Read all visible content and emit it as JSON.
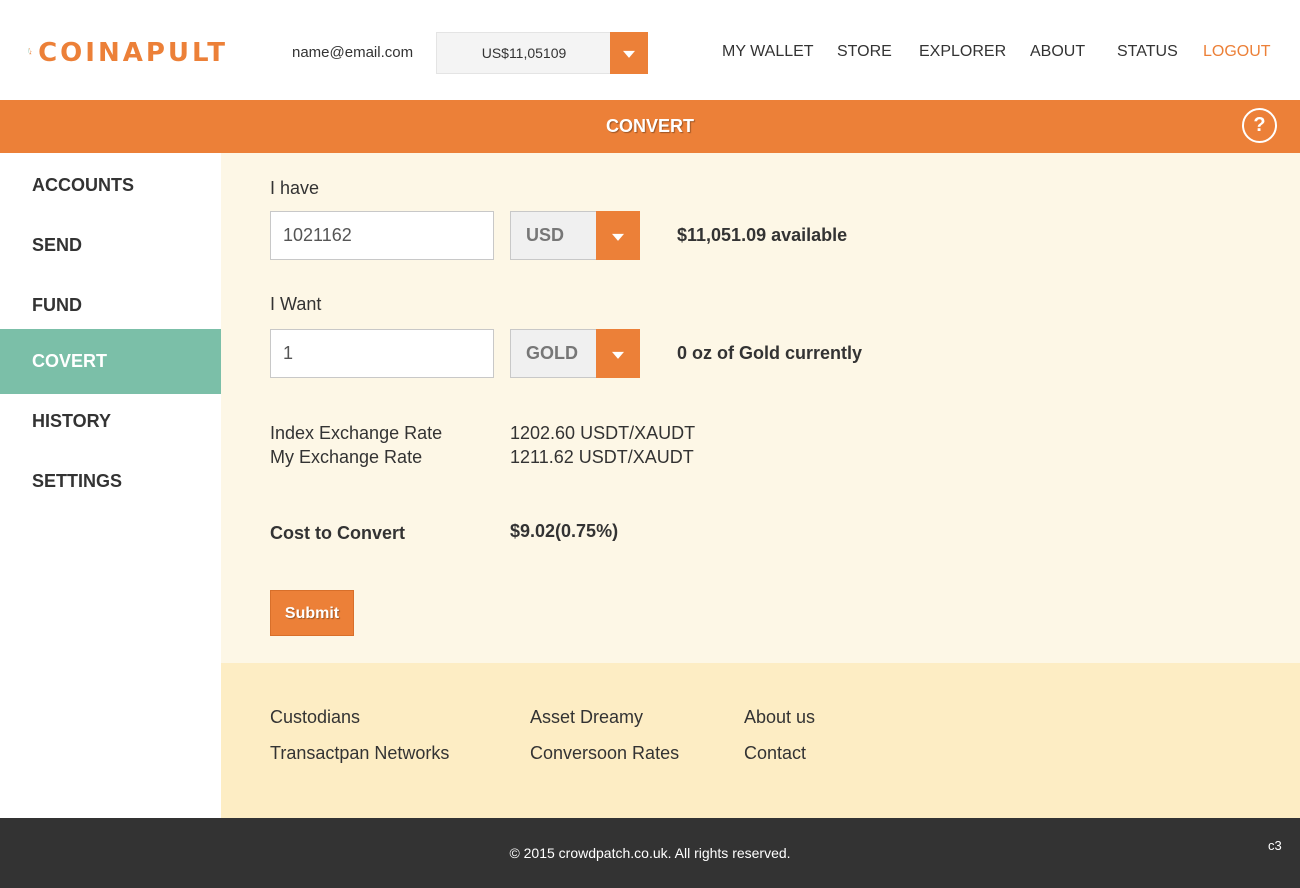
{
  "header": {
    "logo_text": "COINAPULT",
    "email": "name@email.com",
    "balance": "US$11,05109",
    "nav": [
      "MY WALLET",
      "STORE",
      "EXPLORER",
      "ABOUT",
      "STATUS",
      "LOGOUT"
    ]
  },
  "title_bar": {
    "title": "CONVERT",
    "help": "?"
  },
  "sidebar": {
    "items": [
      "ACCOUNTS",
      "SEND",
      "FUND",
      "COVERT",
      "HISTORY",
      "SETTINGS"
    ],
    "active": "COVERT"
  },
  "form": {
    "have_label": "I have",
    "have_amount": "1021162",
    "have_currency": "USD",
    "have_info": "$11,051.09 available",
    "want_label": "I Want",
    "want_amount": "1",
    "want_currency": "GOLD",
    "want_info": "0 oz of Gold currently",
    "index_rate_label": "Index Exchange Rate",
    "index_rate_value": "1202.60 USDT/XAUDT",
    "my_rate_label": "My Exchange Rate",
    "my_rate_value": "1211.62 USDT/XAUDT",
    "cost_label": "Cost to Convert",
    "cost_value": "$9.02(0.75%)",
    "submit": "Submit"
  },
  "footer_links": {
    "col1": [
      "Custodians",
      "Transactpan Networks"
    ],
    "col2": [
      "Asset Dreamy",
      "Conversoon Rates"
    ],
    "col3": [
      "About us",
      "Contact"
    ]
  },
  "bottom": {
    "copyright": "© 2015 crowdpatch.co.uk. All rights reserved.",
    "corner": "c3"
  },
  "colors": {
    "accent": "#ec8038",
    "active_sidebar": "#7bbfa8",
    "main_bg": "#fdf7e6",
    "footer_bg": "#fdedc4",
    "bottom_bg": "#333333"
  }
}
